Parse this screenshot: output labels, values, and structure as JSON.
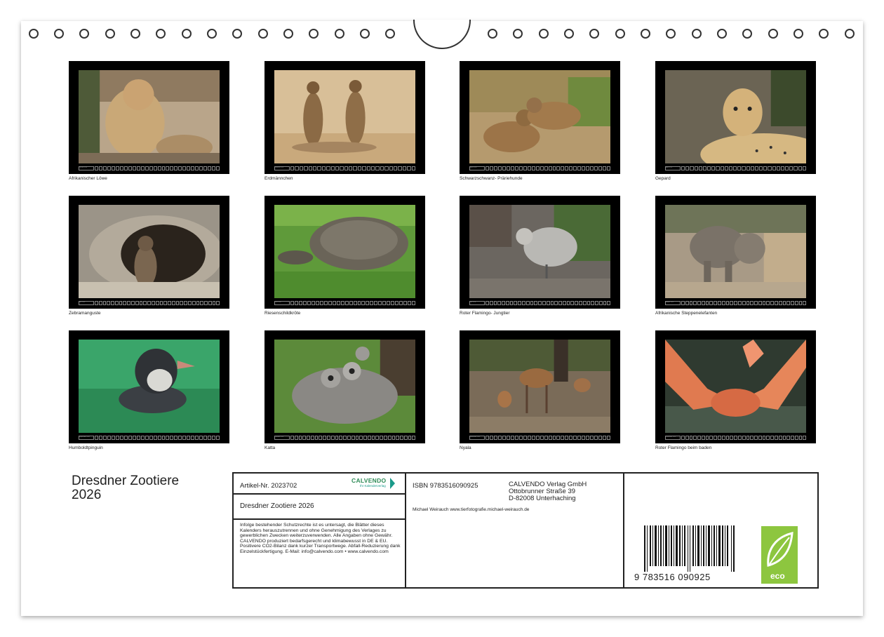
{
  "calendar_title": "Dresdner Zootiere 2026",
  "calendar_title_line1": "Dresdner Zootiere",
  "calendar_title_line2": "2026",
  "months": [
    {
      "caption": "Afrikanischer Löwe",
      "month_label": "Januar 2026"
    },
    {
      "caption": "Erdmännchen",
      "month_label": "Februar 2026"
    },
    {
      "caption": "Schwarzschwanz- Präriehunde",
      "month_label": "März 2026"
    },
    {
      "caption": "Gepard",
      "month_label": "April 2026"
    },
    {
      "caption": "Zebramanguste",
      "month_label": "Mai 2026"
    },
    {
      "caption": "Riesenschildkröte",
      "month_label": "Juni 2026"
    },
    {
      "caption": "Roter Flamingo- Jungtier",
      "month_label": "Juli 2026"
    },
    {
      "caption": "Afrikanische Steppenelefanten",
      "month_label": "August 2026"
    },
    {
      "caption": "Humboldtpinguin",
      "month_label": "September 2026"
    },
    {
      "caption": "Katta",
      "month_label": "Oktober 2026"
    },
    {
      "caption": "Nyala",
      "month_label": "November 2026"
    },
    {
      "caption": "Roter Flamingo beim baden",
      "month_label": "Dezember 2026"
    }
  ],
  "info": {
    "article_no": "Artikel-Nr. 2023702",
    "publisher_logo": "CALVENDO",
    "publisher_logo_sub": "Ihr Kalenderverlag",
    "title": "Dresdner Zootiere 2026",
    "isbn": "ISBN 9783516090925",
    "publisher_name": "CALVENDO Verlag GmbH",
    "publisher_street": "Ottobrunner Straße 39",
    "publisher_city": "D-82008 Unterhaching",
    "author": "Michael Weirauch www.tierfotografie.michael-weirauch.de",
    "legal_text": "Infolge bestehender Schutzrechte ist es untersagt, die Blätter dieses Kalenders herauszutrennen und ohne Genehmigung des Verlages zu gewerblichen Zwecken weiterzuverwenden. Alle Angaben ohne Gewähr. CALVENDO produziert bedarfsgerecht und klimabewusst in DE & EU. Positivere CO2-Bilanz dank kurzer Transportwege. Abfall-Reduzierung dank Einzelstückfertigung. E-Mail: info@calvendo.com • www.calvendo.com",
    "barcode_digits": "9   783516   090925",
    "eco_label": "eco"
  },
  "colors": {
    "eco_green": "#8dc63f",
    "logo_green": "#2e8b57",
    "logo_teal": "#1a9a8a"
  }
}
